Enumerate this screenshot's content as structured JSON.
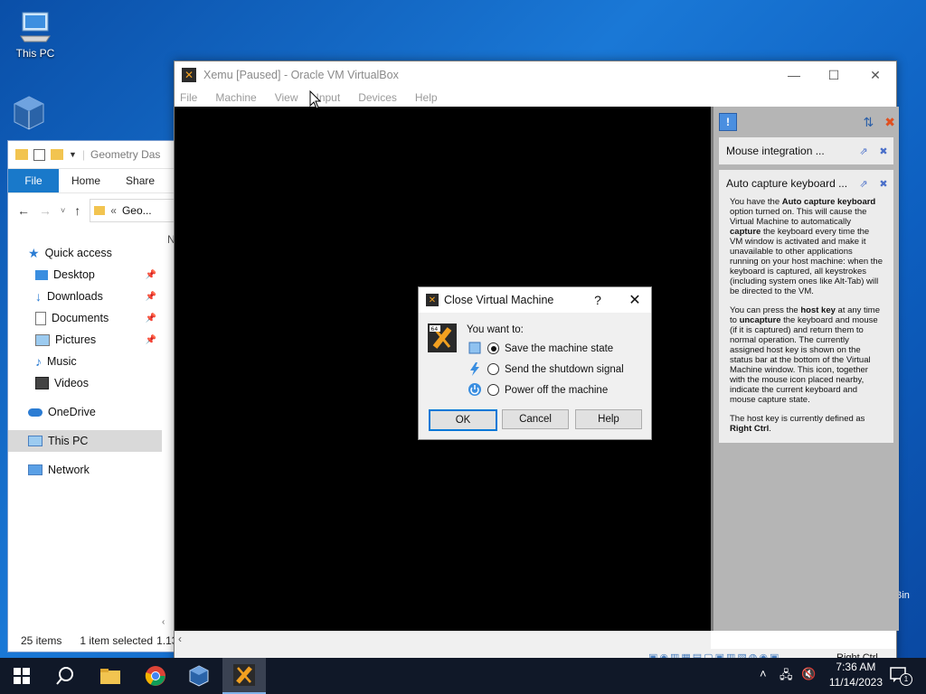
{
  "desktop": {
    "this_pc_label": "This PC",
    "recycle_partial": "Bin"
  },
  "explorer": {
    "title": "Geometry Das",
    "ribbon": {
      "file": "File",
      "home": "Home",
      "share": "Share"
    },
    "address": {
      "chevrons": "«",
      "path": "Geo..."
    },
    "column_header": "N",
    "nav": {
      "quick_access": "Quick access",
      "desktop": "Desktop",
      "downloads": "Downloads",
      "documents": "Documents",
      "pictures": "Pictures",
      "music": "Music",
      "videos": "Videos",
      "onedrive": "OneDrive",
      "this_pc": "This PC",
      "network": "Network"
    },
    "status": {
      "items": "25 items",
      "selected": "1 item selected",
      "size": "1.13"
    }
  },
  "vbox": {
    "title": "Xemu [Paused] - Oracle VM VirtualBox",
    "menu": [
      "File",
      "Machine",
      "View",
      "Input",
      "Devices",
      "Help"
    ],
    "status_host_key": "Right Ctrl"
  },
  "notifications": {
    "mouse_title": "Mouse integration ...",
    "keyboard_title": "Auto capture keyboard ...",
    "p1_a": "You have the ",
    "p1_b": "Auto capture keyboard",
    "p1_c": " option turned on. This will cause the Virtual Machine to automatically ",
    "p1_d": "capture",
    "p1_e": " the keyboard every time the VM window is activated and make it unavailable to other applications running on your host machine: when the keyboard is captured, all keystrokes (including system ones like Alt-Tab) will be directed to the VM.",
    "p2_a": "You can press the ",
    "p2_b": "host key",
    "p2_c": " at any time to ",
    "p2_d": "uncapture",
    "p2_e": " the keyboard and mouse (if it is captured) and return them to normal operation. The currently assigned host key is shown on the status bar at the bottom of the Virtual Machine window. This icon, together with the mouse icon placed nearby, indicate the current keyboard and mouse capture state.",
    "p3_a": "The host key is currently defined as ",
    "p3_b": "Right Ctrl",
    "p3_c": "."
  },
  "dialog": {
    "title": "Close Virtual Machine",
    "help_glyph": "?",
    "prompt": "You want to:",
    "options": [
      "Save the machine state",
      "Send the shutdown signal",
      "Power off the machine"
    ],
    "ok": "OK",
    "cancel": "Cancel",
    "help": "Help"
  },
  "taskbar": {
    "time": "7:36 AM",
    "date": "11/14/2023",
    "notif_count": "1"
  },
  "colors": {
    "accent": "#0078d7",
    "file_tab": "#1979ca",
    "taskbar": "#101828"
  }
}
